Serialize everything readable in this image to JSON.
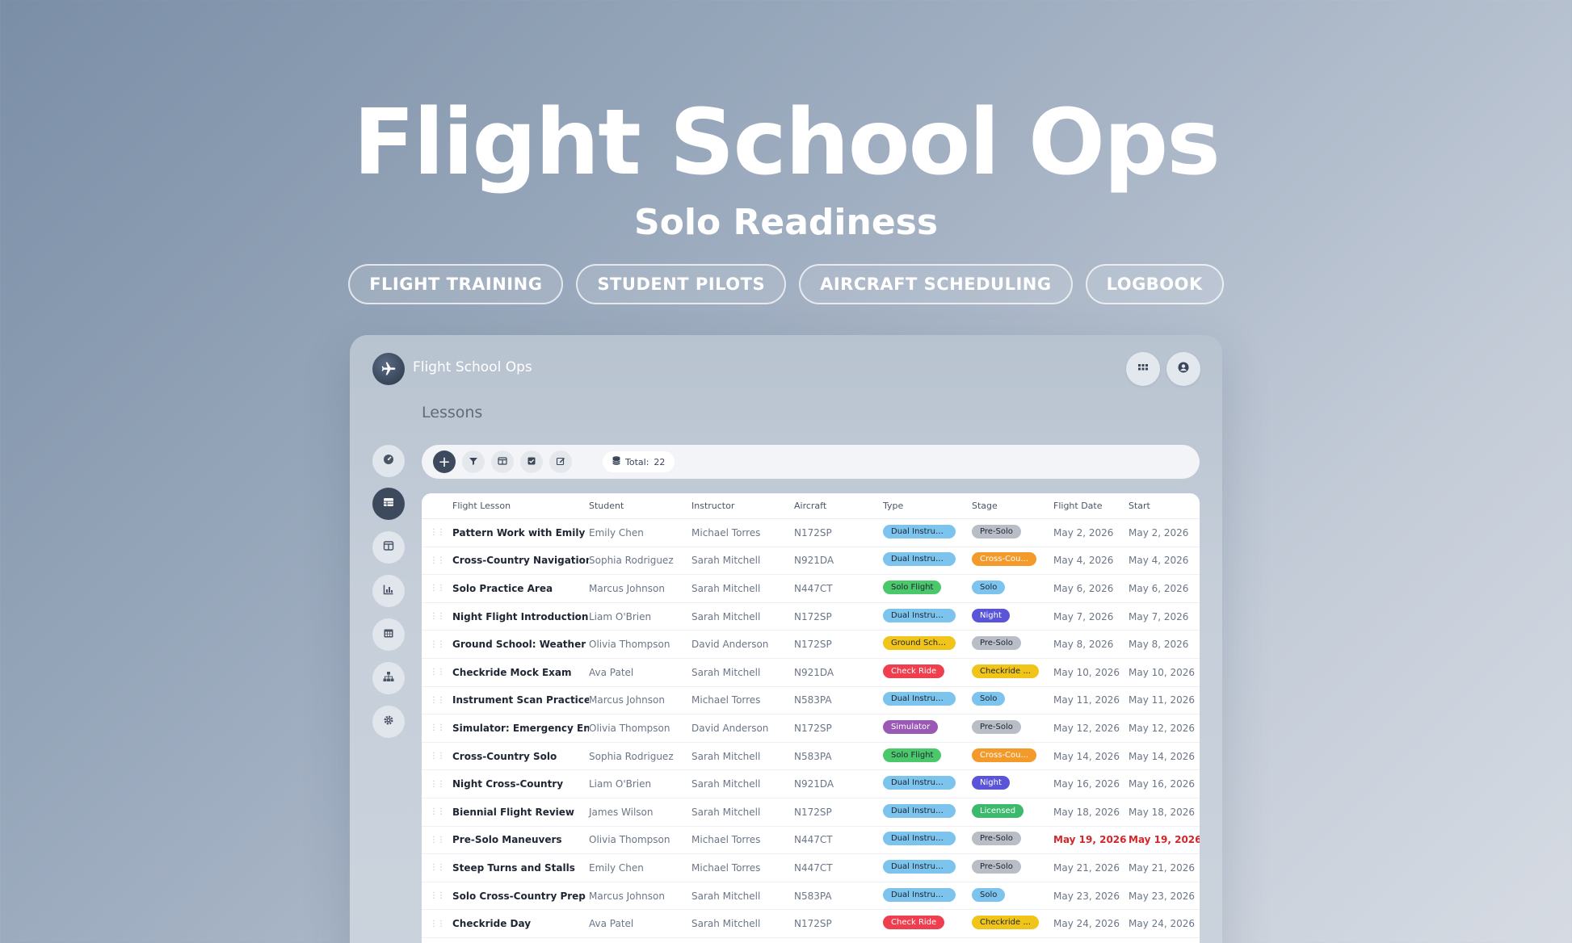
{
  "hero": {
    "title": "Flight School Ops",
    "subtitle": "Solo Readiness",
    "pills": [
      "FLIGHT TRAINING",
      "STUDENT PILOTS",
      "AIRCRAFT SCHEDULING",
      "LOGBOOK"
    ]
  },
  "app": {
    "name": "Flight School Ops",
    "section_title": "Lessons",
    "total_label": "Total:",
    "total_value": "22"
  },
  "colors": {
    "dual": "#7cc4ee",
    "solo_flight": "#4cc86c",
    "ground": "#f0c419",
    "check": "#ef3f4f",
    "sim": "#9b59b6",
    "pre_solo": "#b9bec6",
    "cross_country": "#f39a2b",
    "solo": "#7cc4ee",
    "night": "#5a55d8",
    "checkride": "#f0c419",
    "licensed": "#3cba6b"
  },
  "table": {
    "headers": {
      "lesson": "Flight Lesson",
      "student": "Student",
      "instructor": "Instructor",
      "aircraft": "Aircraft",
      "type": "Type",
      "stage": "Stage",
      "flight_date": "Flight Date",
      "start": "Start"
    },
    "rows": [
      {
        "lesson": "Pattern Work with Emily",
        "student": "Emily Chen",
        "instructor": "Michael Torres",
        "aircraft": "N172SP",
        "type": "Dual Instruct...",
        "type_key": "dual",
        "stage": "Pre-Solo",
        "stage_key": "pre_solo",
        "flight_date": "May 2, 2026",
        "start": "May 2, 2026"
      },
      {
        "lesson": "Cross-Country Navigation",
        "student": "Sophia Rodriguez",
        "instructor": "Sarah Mitchell",
        "aircraft": "N921DA",
        "type": "Dual Instruct...",
        "type_key": "dual",
        "stage": "Cross-Cou...",
        "stage_key": "cross_country",
        "flight_date": "May 4, 2026",
        "start": "May 4, 2026"
      },
      {
        "lesson": "Solo Practice Area",
        "student": "Marcus Johnson",
        "instructor": "Sarah Mitchell",
        "aircraft": "N447CT",
        "type": "Solo Flight",
        "type_key": "solo_flight",
        "stage": "Solo",
        "stage_key": "solo",
        "flight_date": "May 6, 2026",
        "start": "May 6, 2026"
      },
      {
        "lesson": "Night Flight Introduction",
        "student": "Liam O'Brien",
        "instructor": "Sarah Mitchell",
        "aircraft": "N172SP",
        "type": "Dual Instruct...",
        "type_key": "dual",
        "stage": "Night",
        "stage_key": "night",
        "flight_date": "May 7, 2026",
        "start": "May 7, 2026"
      },
      {
        "lesson": "Ground School: Weather",
        "student": "Olivia Thompson",
        "instructor": "David Anderson",
        "aircraft": "N172SP",
        "type": "Ground School",
        "type_key": "ground",
        "stage": "Pre-Solo",
        "stage_key": "pre_solo",
        "flight_date": "May 8, 2026",
        "start": "May 8, 2026"
      },
      {
        "lesson": "Checkride Mock Exam",
        "student": "Ava Patel",
        "instructor": "Sarah Mitchell",
        "aircraft": "N921DA",
        "type": "Check Ride",
        "type_key": "check",
        "stage": "Checkride ...",
        "stage_key": "checkride",
        "flight_date": "May 10, 2026",
        "start": "May 10, 2026"
      },
      {
        "lesson": "Instrument Scan Practice",
        "student": "Marcus Johnson",
        "instructor": "Michael Torres",
        "aircraft": "N583PA",
        "type": "Dual Instruct...",
        "type_key": "dual",
        "stage": "Solo",
        "stage_key": "solo",
        "flight_date": "May 11, 2026",
        "start": "May 11, 2026"
      },
      {
        "lesson": "Simulator: Emergency En...",
        "student": "Olivia Thompson",
        "instructor": "David Anderson",
        "aircraft": "N172SP",
        "type": "Simulator",
        "type_key": "sim",
        "stage": "Pre-Solo",
        "stage_key": "pre_solo",
        "flight_date": "May 12, 2026",
        "start": "May 12, 2026"
      },
      {
        "lesson": "Cross-Country Solo",
        "student": "Sophia Rodriguez",
        "instructor": "Sarah Mitchell",
        "aircraft": "N583PA",
        "type": "Solo Flight",
        "type_key": "solo_flight",
        "stage": "Cross-Cou...",
        "stage_key": "cross_country",
        "flight_date": "May 14, 2026",
        "start": "May 14, 2026"
      },
      {
        "lesson": "Night Cross-Country",
        "student": "Liam O'Brien",
        "instructor": "Sarah Mitchell",
        "aircraft": "N921DA",
        "type": "Dual Instruct...",
        "type_key": "dual",
        "stage": "Night",
        "stage_key": "night",
        "flight_date": "May 16, 2026",
        "start": "May 16, 2026"
      },
      {
        "lesson": "Biennial Flight Review",
        "student": "James Wilson",
        "instructor": "Sarah Mitchell",
        "aircraft": "N172SP",
        "type": "Dual Instruct...",
        "type_key": "dual",
        "stage": "Licensed",
        "stage_key": "licensed",
        "flight_date": "May 18, 2026",
        "start": "May 18, 2026"
      },
      {
        "lesson": "Pre-Solo Maneuvers",
        "student": "Olivia Thompson",
        "instructor": "Michael Torres",
        "aircraft": "N447CT",
        "type": "Dual Instruct...",
        "type_key": "dual",
        "stage": "Pre-Solo",
        "stage_key": "pre_solo",
        "flight_date": "May 19, 2026",
        "start": "May 19, 2026",
        "overdue": true
      },
      {
        "lesson": "Steep Turns and Stalls",
        "student": "Emily Chen",
        "instructor": "Michael Torres",
        "aircraft": "N447CT",
        "type": "Dual Instruct...",
        "type_key": "dual",
        "stage": "Pre-Solo",
        "stage_key": "pre_solo",
        "flight_date": "May 21, 2026",
        "start": "May 21, 2026"
      },
      {
        "lesson": "Solo Cross-Country Prep",
        "student": "Marcus Johnson",
        "instructor": "Sarah Mitchell",
        "aircraft": "N583PA",
        "type": "Dual Instruct...",
        "type_key": "dual",
        "stage": "Solo",
        "stage_key": "solo",
        "flight_date": "May 23, 2026",
        "start": "May 23, 2026"
      },
      {
        "lesson": "Checkride Day",
        "student": "Ava Patel",
        "instructor": "Sarah Mitchell",
        "aircraft": "N172SP",
        "type": "Check Ride",
        "type_key": "check",
        "stage": "Checkride ...",
        "stage_key": "checkride",
        "flight_date": "May 24, 2026",
        "start": "May 24, 2026"
      }
    ]
  }
}
